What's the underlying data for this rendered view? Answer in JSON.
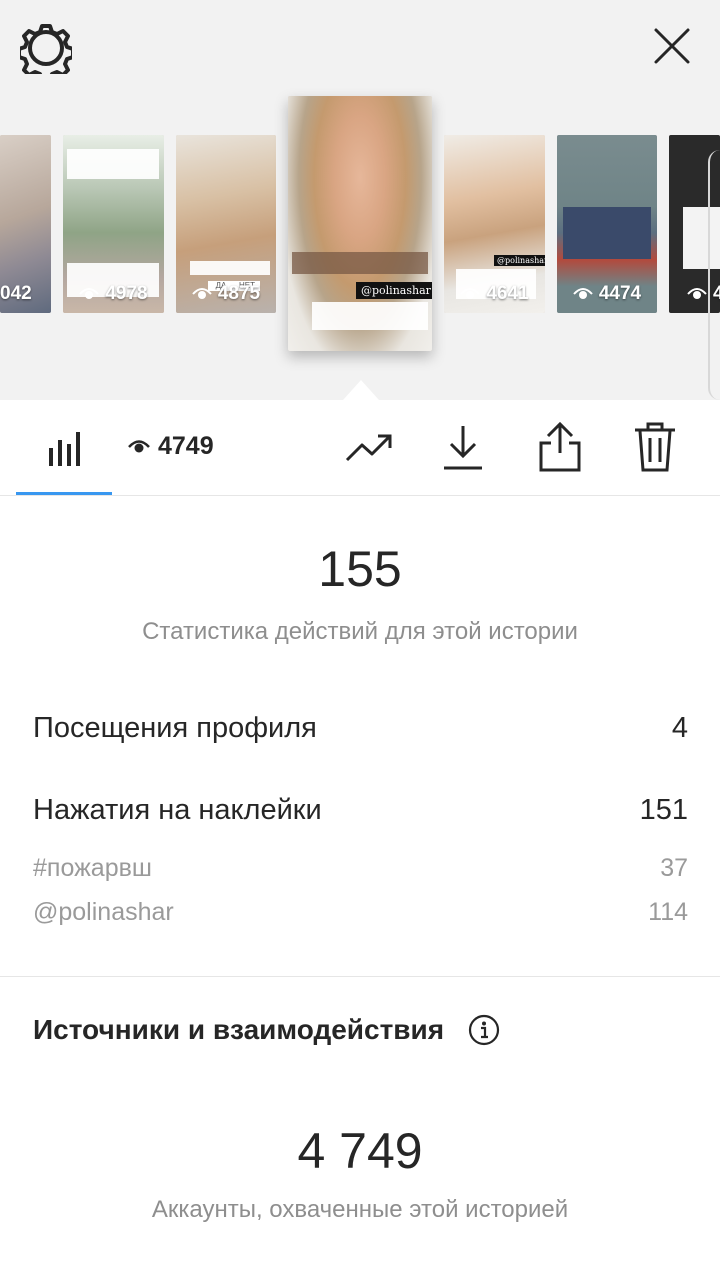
{
  "header": {
    "settings_icon": "gear-icon",
    "close_icon": "close-icon"
  },
  "stories": [
    {
      "views": "042"
    },
    {
      "views": "4978"
    },
    {
      "views": "4875",
      "poll_yes": "ДА",
      "poll_no": "НЕТ"
    },
    {
      "views": "4749",
      "tag": "@polinashar",
      "selected": true
    },
    {
      "views": "4641",
      "tag": "@polinashar"
    },
    {
      "views": "4474"
    },
    {
      "views": "4"
    }
  ],
  "toolbar": {
    "insights_icon": "bar-chart-icon",
    "eye_icon": "eye-icon",
    "views": "4749",
    "promote_icon": "trending-up-icon",
    "download_icon": "download-icon",
    "share_icon": "share-icon",
    "delete_icon": "trash-icon"
  },
  "interactions": {
    "total": "155",
    "label": "Статистика действий для этой истории",
    "profile_visits_label": "Посещения профиля",
    "profile_visits_value": "4",
    "sticker_taps_label": "Нажатия на наклейки",
    "sticker_taps_value": "151",
    "stickers": [
      {
        "name": "#пожарвш",
        "value": "37"
      },
      {
        "name": "@polinashar",
        "value": "114"
      }
    ]
  },
  "discovery": {
    "title": "Источники и взаимодействия",
    "info_icon": "info-icon",
    "reach": "4 749",
    "reach_label": "Аккаунты, охваченные этой историей"
  },
  "colors": {
    "accent": "#3897f0",
    "text": "#262626",
    "secondary": "#8e8e8e"
  }
}
